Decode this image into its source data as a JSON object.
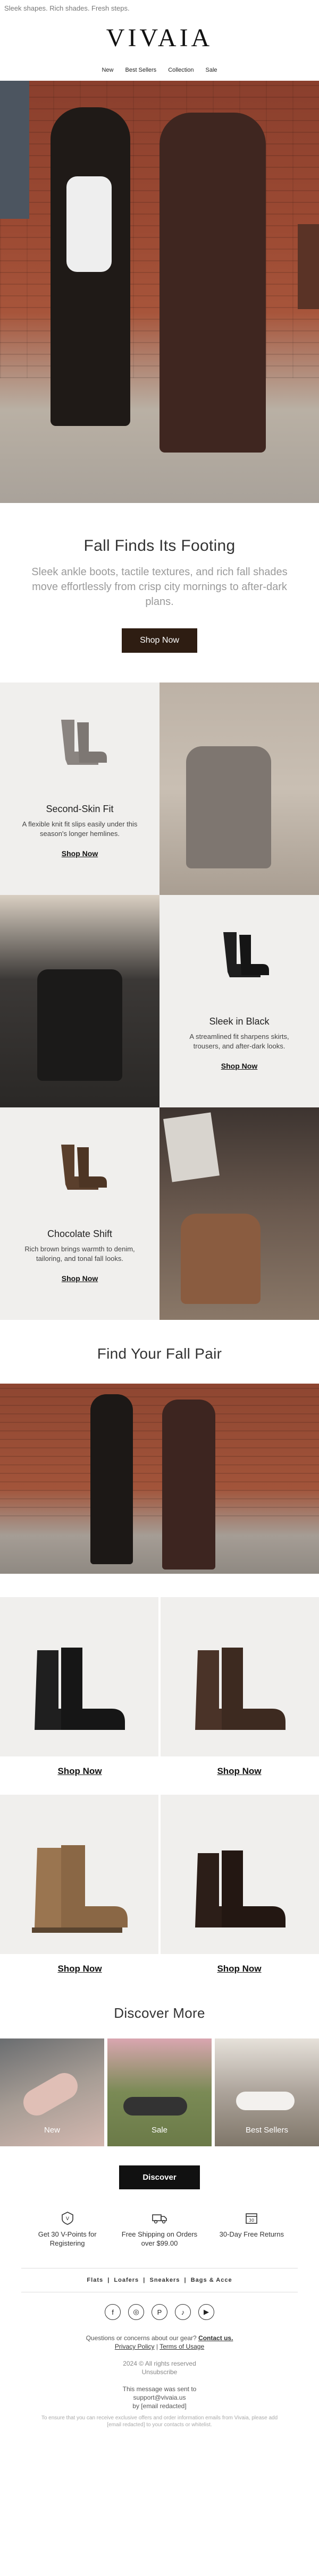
{
  "preheader": "Sleek shapes. Rich shades. Fresh steps.",
  "brand": {
    "logo": "VIVAIA"
  },
  "nav": [
    {
      "label": "New"
    },
    {
      "label": "Best Sellers"
    },
    {
      "label": "Collection"
    },
    {
      "label": "Sale"
    }
  ],
  "intro": {
    "title": "Fall Finds Its Footing",
    "subtitle": "Sleek ankle boots, tactile textures, and rich fall shades move effortlessly from crisp city mornings to after-dark plans.",
    "cta": "Shop Now"
  },
  "features": [
    {
      "title": "Second-Skin Fit",
      "desc": "A flexible knit fit slips easily under this season's longer hemlines.",
      "link": "Shop Now"
    },
    {
      "title": "Sleek in Black",
      "desc": "A streamlined fit sharpens skirts, trousers, and after-dark looks.",
      "link": "Shop Now"
    },
    {
      "title": "Chocolate Shift",
      "desc": "Rich brown brings warmth to denim, tailoring, and tonal fall looks.",
      "link": "Shop Now"
    }
  ],
  "pair": {
    "title": "Find Your Fall Pair",
    "products": [
      {
        "link": "Shop Now"
      },
      {
        "link": "Shop Now"
      },
      {
        "link": "Shop Now"
      },
      {
        "link": "Shop Now"
      }
    ]
  },
  "discover": {
    "title": "Discover More",
    "tiles": [
      {
        "label": "New"
      },
      {
        "label": "Sale"
      },
      {
        "label": "Best Sellers"
      }
    ],
    "cta": "Discover"
  },
  "benefits": [
    {
      "icon": "badge-icon",
      "text": "Get 30 V-Points for Registering"
    },
    {
      "icon": "truck-icon",
      "text": "Free Shipping on Orders over $99.00"
    },
    {
      "icon": "return-box-icon",
      "text": "30-Day Free Returns"
    }
  ],
  "categories": [
    "Flats",
    "Loafers",
    "Sneakers",
    "Bags & Acce"
  ],
  "social": [
    {
      "icon": "facebook-icon",
      "glyph": "f"
    },
    {
      "icon": "instagram-icon",
      "glyph": "◎"
    },
    {
      "icon": "pinterest-icon",
      "glyph": "P"
    },
    {
      "icon": "tiktok-icon",
      "glyph": "♪"
    },
    {
      "icon": "youtube-icon",
      "glyph": "▶"
    }
  ],
  "footer": {
    "question": "Questions or concerns about our gear?",
    "contact": "Contact us.",
    "privacy": "Privacy Policy",
    "sep": "|",
    "terms": "Terms of Usage",
    "copyright": "2024 © All rights reserved",
    "unsubscribe": "Unsubscribe",
    "sent_to": "This message was sent to",
    "email": "support@vivaia.us",
    "by": "by [email redacted]",
    "notice": "To ensure that you can receive exclusive offers and order information emails from Vivaia, please add [email redacted] to your contacts or whitelist."
  },
  "colors": {
    "cta_brown": "#2e1d12",
    "cta_black": "#111111",
    "panel_gray": "#f0efed"
  }
}
